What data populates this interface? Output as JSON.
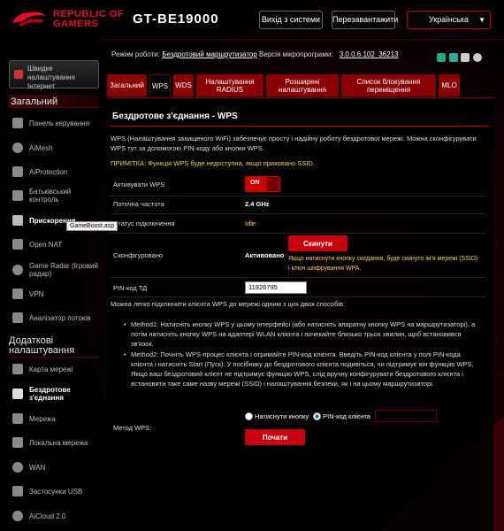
{
  "header": {
    "brand_line1": "REPUBLIC OF",
    "brand_line2": "GAMERS",
    "model": "GT-BE19000",
    "logout_label": "Вихід з системи",
    "reboot_label": "Перезавантажити",
    "language": "Українська"
  },
  "sidebar": {
    "quick_setup_label": "Швидке налаштування Інтернет",
    "section_general": "Загальний",
    "general_items": [
      {
        "label": "Панель керування",
        "icon": "dashboard-icon"
      },
      {
        "label": "AiMesh",
        "icon": "aimesh-icon"
      },
      {
        "label": "AiProtection",
        "icon": "shield-icon"
      },
      {
        "label": "Батьківський контроль",
        "icon": "parental-icon"
      },
      {
        "label": "Прискорення",
        "icon": "rocket-icon"
      },
      {
        "label": "Open NAT",
        "icon": "open-nat-icon"
      },
      {
        "label": "Game Radar (Ігровий радар)",
        "icon": "radar-icon"
      },
      {
        "label": "VPN",
        "icon": "vpn-icon"
      },
      {
        "label": "Аналізатор потоків",
        "icon": "traffic-analyzer-icon"
      }
    ],
    "section_advanced": "Додаткові налаштування",
    "advanced_items": [
      {
        "label": "Карта мережі",
        "icon": "network-map-icon"
      },
      {
        "label": "Бездротове з'єднання",
        "icon": "wireless-icon"
      },
      {
        "label": "Мережа",
        "icon": "network-icon"
      },
      {
        "label": "Локальна мережа",
        "icon": "lan-icon"
      },
      {
        "label": "WAN",
        "icon": "wan-icon"
      },
      {
        "label": "Застосунки USB",
        "icon": "usb-icon"
      },
      {
        "label": "AiCloud 2.0",
        "icon": "cloud-icon"
      }
    ],
    "tooltip": "GameBoost.asp"
  },
  "topbar": {
    "mode_label": "Режим роботи:",
    "mode_value": "Бездротовий маршрутизатор",
    "fw_label": "Версія мікропрограми:",
    "fw_value": "3.0.0.6.102_36213"
  },
  "tabs": [
    {
      "label": "Загальний"
    },
    {
      "label": "WPS"
    },
    {
      "label": "WDS"
    },
    {
      "label": "Налаштування RADIUS"
    },
    {
      "label": "Розширені налаштування"
    },
    {
      "label": "Список блокування переміщення"
    },
    {
      "label": "MLO"
    }
  ],
  "main": {
    "title": "Бездротове з'єднання - WPS",
    "description": "WPS (Налаштування захищеного WiFi) забезпечує просту і надійну роботу бездротової мережі. Можна сконфігурувати WPS тут за допомогою PIN-коду або кнопки WPS.",
    "note": "ПРИМІТКА: Функція WPS буде недоступна, якщо приховано SSID.",
    "enable_label": "Активувати WPS",
    "enable_value": "ON",
    "freq_label": "Поточна частота",
    "freq_value": "2.4 GHz",
    "status_label": "Статус підключення",
    "status_value": "Idle",
    "configured_label": "Сконфігуровано",
    "configured_value": "Активовано",
    "reset_label": "Скинути",
    "reset_hint": "Якщо натиснути кнопку скидання, буде скинуто ім'я мережі (SSID) і ключ шифрування WPA.",
    "pin_label": "PIN-код ТД",
    "pin_value": "11926795",
    "howto": "Можна легко підключити клієнта WPS до мережі одним з цих двох способів:",
    "method1": "Method1: Натисніть кнопку WPS у цьому інтерфейсі (або натисніть апаратну кнопку WPS на маршрутизаторі), а потім натисніть кнопку WPS на адаптері WLAN клієнта і почекайте близько трьох хвилин, щоб встановився зв'язок.",
    "method2": "Method2: Почніть WPS-процес клієнта і отримайте PIN-код клієнта. Введіть PIN-код клієнта у полі PIN-кода клієнта і натисніть Start (Пуск). У посібнику до бездротового клієнта подивіться, чи підтримує він функцію WPS. Якщо ваш бездротовий клієнт не підтримує функцію WPS, слід вручну конфігурувати бездротового клієнта і встановити таке саме назву мережі (SSID) і налаштування безпеки, як і на цьому маршрутизаторі.",
    "wps_method_label": "Метод WPS:",
    "option_button": "Натиснути кнопку",
    "option_pin": "PIN-код клієнта",
    "start_label": "Почати"
  }
}
